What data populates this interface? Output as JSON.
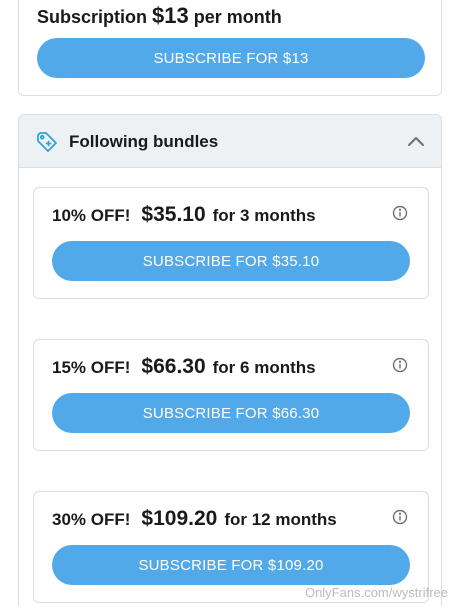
{
  "subscription": {
    "prefix": "Subscription",
    "price": "$13",
    "suffix": "per month",
    "button_label": "SUBSCRIBE FOR $13"
  },
  "bundles": {
    "title": "Following bundles",
    "icon": "tag-icon",
    "collapse_icon": "chevron-up-icon",
    "items": [
      {
        "discount": "10% OFF!",
        "price": "$35.10",
        "duration": "for 3 months",
        "button_label": "SUBSCRIBE FOR $35.10"
      },
      {
        "discount": "15% OFF!",
        "price": "$66.30",
        "duration": "for 6 months",
        "button_label": "SUBSCRIBE FOR $66.30"
      },
      {
        "discount": "30% OFF!",
        "price": "$109.20",
        "duration": "for 12 months",
        "button_label": "SUBSCRIBE FOR $109.20"
      }
    ]
  },
  "watermark": "OnlyFans.com/wystrifree",
  "colors": {
    "accent": "#52a9ea",
    "header_bg": "#eef1f3",
    "border": "#dcdfe2"
  }
}
